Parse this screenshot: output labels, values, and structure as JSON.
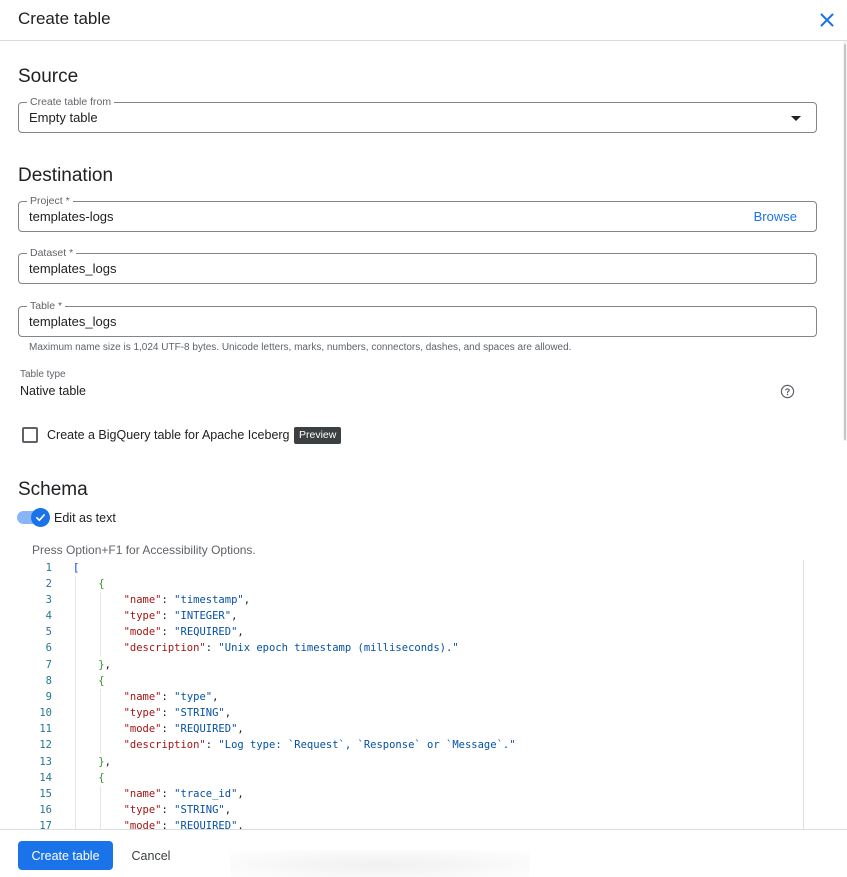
{
  "dialog": {
    "title": "Create table"
  },
  "source": {
    "heading": "Source",
    "create_from_label": "Create table from",
    "create_from_value": "Empty table"
  },
  "destination": {
    "heading": "Destination",
    "project_label": "Project *",
    "project_value": "templates-logs",
    "browse_label": "Browse",
    "dataset_label": "Dataset *",
    "dataset_value": "templates_logs",
    "table_label": "Table *",
    "table_value": "templates_logs",
    "helper_text": "Maximum name size is 1,024 UTF-8 bytes. Unicode letters, marks, numbers, connectors, dashes, and spaces are allowed.",
    "table_type_label": "Table type",
    "table_type_value": "Native table",
    "iceberg_label": "Create a BigQuery table for Apache Iceberg",
    "iceberg_checked": false,
    "preview_badge": "Preview"
  },
  "schema": {
    "heading": "Schema",
    "edit_as_text_label": "Edit as text",
    "edit_as_text_on": true,
    "accessibility_hint": "Press Option+F1 for Accessibility Options.",
    "line_numbers": [
      "1",
      "2",
      "3",
      "4",
      "5",
      "6",
      "7",
      "8",
      "9",
      "10",
      "11",
      "12",
      "13",
      "14",
      "15",
      "16",
      "17"
    ]
  },
  "footer": {
    "create_label": "Create table",
    "cancel_label": "Cancel"
  },
  "colors": {
    "accent": "#1a73e8",
    "json_key": "#a31515",
    "json_string": "#0451a5",
    "line_number": "#237893",
    "bracket_outer": "#0431fa",
    "bracket_inner": "#319331"
  },
  "icons": {
    "close": "close-icon",
    "dropdown": "chevron-down-icon",
    "help": "help-icon",
    "check": "check-icon"
  }
}
